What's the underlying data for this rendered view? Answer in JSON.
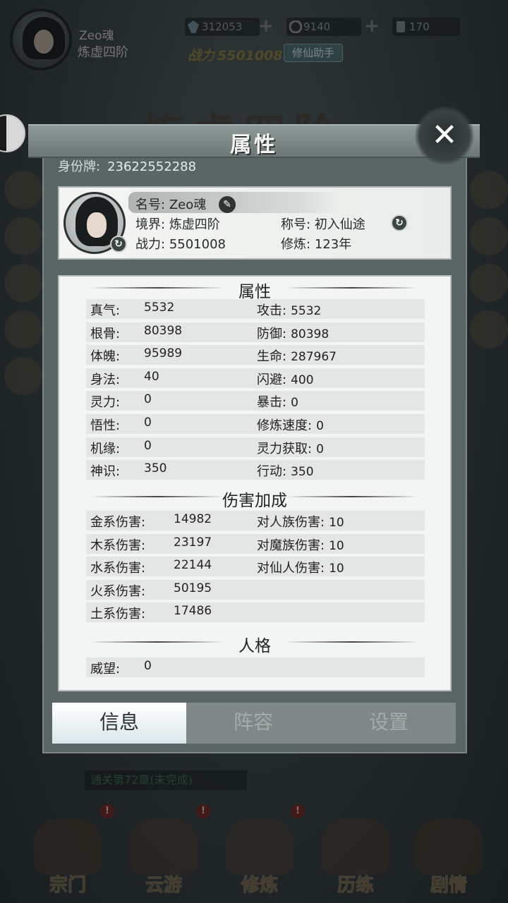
{
  "background": {
    "title_art": "炼虚四阶",
    "player": {
      "name": "Zeo魂",
      "realm": "炼虚四阶"
    },
    "resources": [
      {
        "icon": "spirit-stone-icon",
        "value": "312053"
      },
      {
        "icon": "jade-coin-icon",
        "value": "9140"
      },
      {
        "icon": "scroll-icon",
        "value": "170"
      }
    ],
    "power_label": "战力",
    "power_value": "5501008",
    "helper_button": "修仙助手",
    "chapter_text": "通关第72章(未完成)",
    "nav": [
      {
        "label": "宗门",
        "badge": "!"
      },
      {
        "label": "云游",
        "badge": "!"
      },
      {
        "label": "修炼",
        "badge": ""
      },
      {
        "label": "历练",
        "badge": "!"
      },
      {
        "label": "剧情",
        "badge": ""
      }
    ]
  },
  "modal": {
    "title": "属性",
    "close_label": "✕",
    "id_label": "身份牌:",
    "id_value": "23622552288",
    "card": {
      "name_label": "名号:",
      "name_value": "Zeo魂",
      "realm_label": "境界:",
      "realm_value": "炼虚四阶",
      "power_label": "战力:",
      "power_value": "5501008",
      "title_label": "称号:",
      "title_value": "初入仙途",
      "cultivation_label": "修炼:",
      "cultivation_value": "123年"
    },
    "sections": {
      "attributes": "属性",
      "damage": "伤害加成",
      "personality": "人格"
    },
    "attributes": [
      {
        "l1": "真气:",
        "v1": "5532",
        "l2": "攻击:",
        "v2": "5532"
      },
      {
        "l1": "根骨:",
        "v1": "80398",
        "l2": "防御:",
        "v2": "80398"
      },
      {
        "l1": "体魄:",
        "v1": "95989",
        "l2": "生命:",
        "v2": "287967"
      },
      {
        "l1": "身法:",
        "v1": "40",
        "l2": "闪避:",
        "v2": "400"
      },
      {
        "l1": "灵力:",
        "v1": "0",
        "l2": "暴击:",
        "v2": "0"
      },
      {
        "l1": "悟性:",
        "v1": "0",
        "l2": "修炼速度:",
        "v2": "0"
      },
      {
        "l1": "机缘:",
        "v1": "0",
        "l2": "灵力获取:",
        "v2": "0"
      },
      {
        "l1": "神识:",
        "v1": "350",
        "l2": "行动:",
        "v2": "350"
      }
    ],
    "damage": [
      {
        "l1": "金系伤害:",
        "v1": "14982",
        "l2": "对人族伤害:",
        "v2": "10"
      },
      {
        "l1": "木系伤害:",
        "v1": "23197",
        "l2": "对魔族伤害:",
        "v2": "10"
      },
      {
        "l1": "水系伤害:",
        "v1": "22144",
        "l2": "对仙人伤害:",
        "v2": "10"
      },
      {
        "l1": "火系伤害:",
        "v1": "50195",
        "l2": "",
        "v2": ""
      },
      {
        "l1": "土系伤害:",
        "v1": "17486",
        "l2": "",
        "v2": ""
      }
    ],
    "personality": [
      {
        "l1": "威望:",
        "v1": "0"
      }
    ],
    "tabs": [
      {
        "label": "信息",
        "active": true
      },
      {
        "label": "阵容",
        "active": false
      },
      {
        "label": "设置",
        "active": false
      }
    ]
  }
}
